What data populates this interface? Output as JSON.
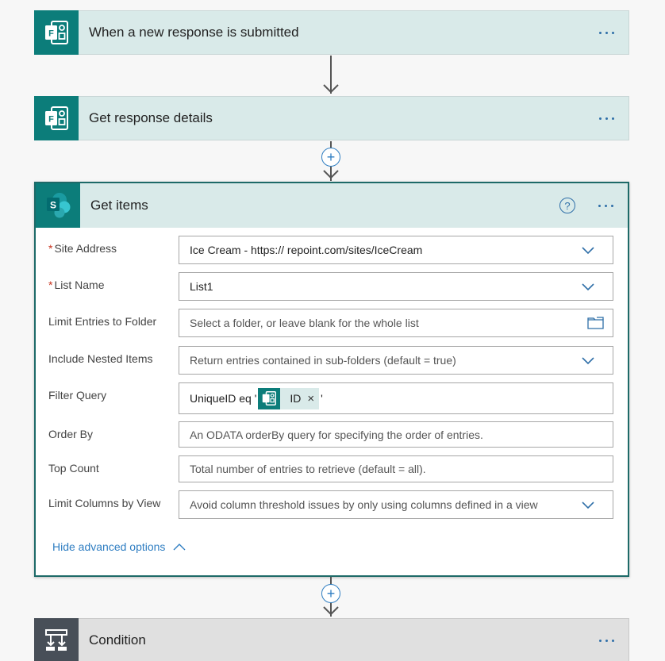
{
  "steps": {
    "trigger": {
      "title": "When a new response is submitted",
      "icon": "forms-icon"
    },
    "get_response": {
      "title": "Get response details",
      "icon": "forms-icon"
    },
    "get_items": {
      "title": "Get items",
      "icon": "sharepoint-icon",
      "help_label": "?",
      "fields": {
        "site_address": {
          "label": "Site Address",
          "required": "*",
          "value": "Ice Cream - https://          repoint.com/sites/IceCream"
        },
        "list_name": {
          "label": "List Name",
          "required": "*",
          "value": "List1"
        },
        "limit_folder": {
          "label": "Limit Entries to Folder",
          "placeholder": "Select a folder, or leave blank for the whole list"
        },
        "nested_items": {
          "label": "Include Nested Items",
          "placeholder": "Return entries contained in sub-folders (default = true)"
        },
        "filter_query": {
          "label": "Filter Query",
          "prefix": "UniqueID eq '",
          "token_label": "ID",
          "token_remove": "×",
          "suffix": "'"
        },
        "order_by": {
          "label": "Order By",
          "placeholder": "An ODATA orderBy query for specifying the order of entries."
        },
        "top_count": {
          "label": "Top Count",
          "placeholder": "Total number of entries to retrieve (default = all)."
        },
        "limit_columns": {
          "label": "Limit Columns by View",
          "placeholder": "Avoid column threshold issues by only using columns defined in a view"
        }
      },
      "advanced_link": "Hide advanced options"
    },
    "condition": {
      "title": "Condition",
      "icon": "condition-icon"
    }
  },
  "colors": {
    "accent": "#0c7d7a",
    "link": "#2f7ec2",
    "header_bg": "#d9eae9",
    "condition_bg": "#e0e0e0",
    "required": "#c8321e"
  }
}
